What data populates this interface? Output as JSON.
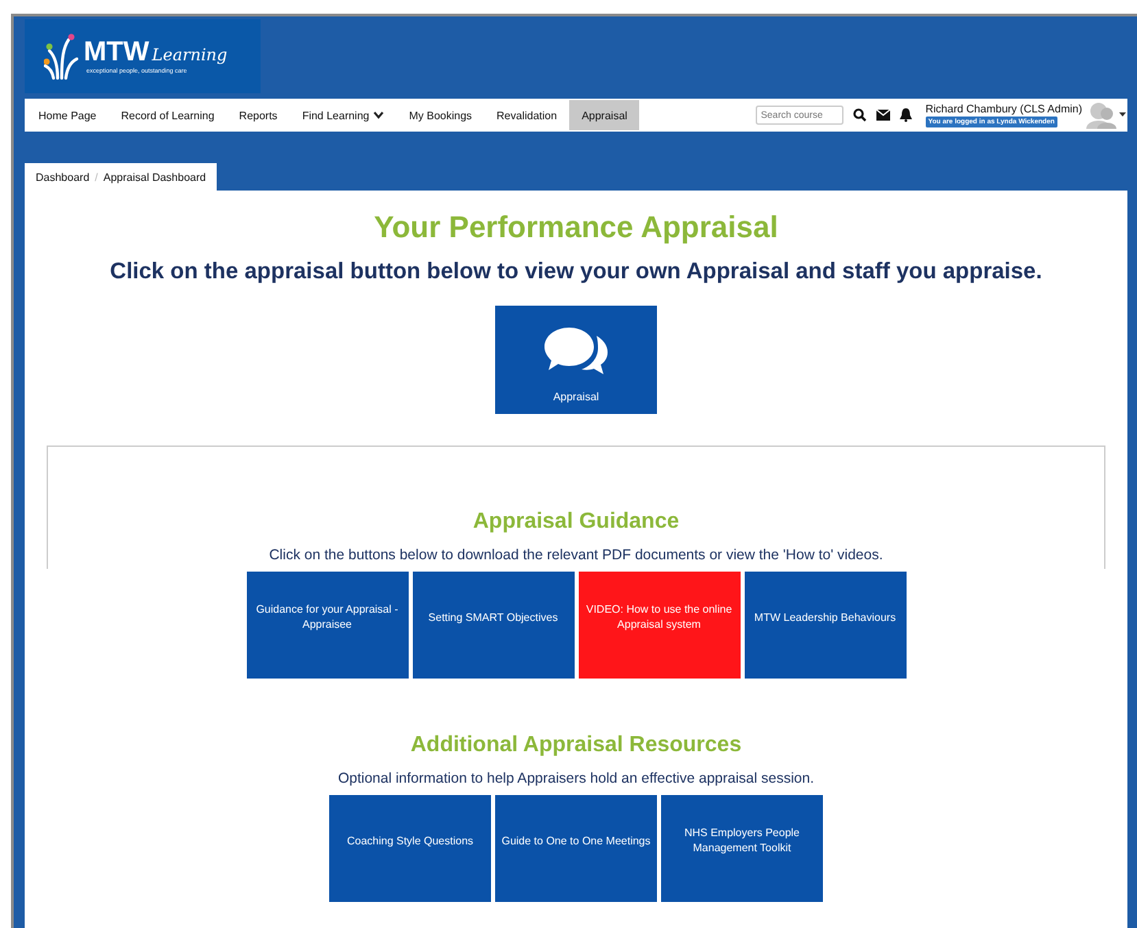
{
  "logo": {
    "brand": "MTW",
    "word": "Learning",
    "tagline": "exceptional people, outstanding care"
  },
  "nav": [
    {
      "label": "Home Page",
      "selected": false,
      "dropdown": false
    },
    {
      "label": "Record of Learning",
      "selected": false,
      "dropdown": false
    },
    {
      "label": "Reports",
      "selected": false,
      "dropdown": false
    },
    {
      "label": "Find Learning",
      "selected": false,
      "dropdown": true
    },
    {
      "label": "My Bookings",
      "selected": false,
      "dropdown": false
    },
    {
      "label": "Revalidation",
      "selected": false,
      "dropdown": false
    },
    {
      "label": "Appraisal",
      "selected": true,
      "dropdown": false
    }
  ],
  "search": {
    "placeholder": "Search course"
  },
  "user": {
    "name": "Richard Chambury (CLS Admin)",
    "badge": "You are logged in as Lynda Wickenden"
  },
  "breadcrumb": [
    "Dashboard",
    "Appraisal Dashboard"
  ],
  "breadcrumb_separator": "/",
  "title": "Your Performance Appraisal",
  "subtitle": "Click on the appraisal button below to view your own Appraisal and staff you appraise.",
  "appraisal_button": "Appraisal",
  "guidance": {
    "heading": "Appraisal Guidance",
    "text": "Click on the buttons below to download the relevant PDF documents or view the 'How to' videos.",
    "tiles": [
      {
        "label": "Guidance for your Appraisal - Appraisee",
        "color": "#0b52a8"
      },
      {
        "label": "Setting SMART Objectives",
        "color": "#0b52a8"
      },
      {
        "label": "VIDEO: How to use the online Appraisal system",
        "color": "#ff1519"
      },
      {
        "label": "MTW Leadership Behaviours",
        "color": "#0b52a8"
      }
    ]
  },
  "resources": {
    "heading": "Additional Appraisal Resources",
    "text": "Optional information to help Appraisers hold an effective appraisal session.",
    "tiles": [
      {
        "label": "Coaching Style Questions",
        "color": "#0b52a8"
      },
      {
        "label": "Guide to One to One Meetings",
        "color": "#0b52a8"
      },
      {
        "label": "NHS Employers People Management Toolkit",
        "color": "#0b52a8"
      }
    ]
  }
}
